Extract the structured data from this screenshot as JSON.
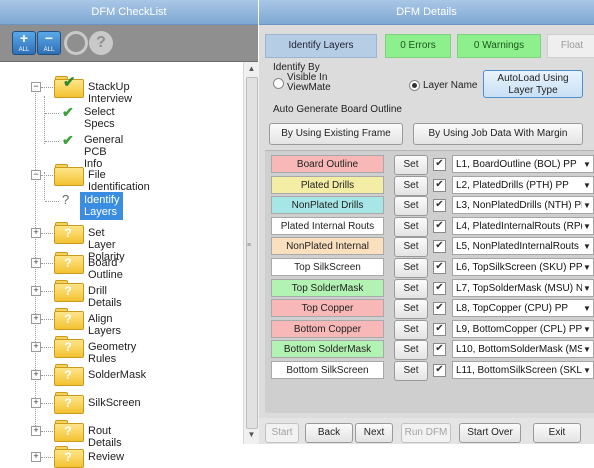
{
  "left_panel": {
    "title": "DFM CheckList"
  },
  "toolbar": {
    "add_symbol": "+",
    "add_label": "ALL",
    "remove_symbol": "−",
    "remove_label": "ALL",
    "help_symbol": "?"
  },
  "tree": {
    "items": [
      {
        "label": "StackUp Interview",
        "expanded": true,
        "icon": "folder-check-icon"
      },
      {
        "label": "Select Specs",
        "icon": "check-icon"
      },
      {
        "label": "General PCB Info",
        "icon": "check-icon"
      },
      {
        "label": "File Identification",
        "expanded": true,
        "icon": "folder-icon"
      },
      {
        "label": "Identify Layers",
        "icon": "question-icon",
        "selected": true
      },
      {
        "label": "Set Layer Polarity",
        "icon": "folder-question-icon"
      },
      {
        "label": "Board Outline",
        "icon": "folder-question-icon"
      },
      {
        "label": "Drill Details",
        "icon": "folder-question-icon"
      },
      {
        "label": "Align Layers",
        "icon": "folder-question-icon"
      },
      {
        "label": "Geometry Rules",
        "icon": "folder-question-icon"
      },
      {
        "label": "SolderMask",
        "icon": "folder-question-icon"
      },
      {
        "label": "SilkScreen",
        "icon": "folder-question-icon"
      },
      {
        "label": "Rout Details",
        "icon": "folder-question-icon"
      },
      {
        "label": "Review",
        "icon": "folder-question-icon"
      }
    ],
    "folder_q": "?",
    "check": "✔",
    "expander_minus": "−",
    "expander_plus": "+"
  },
  "right_panel": {
    "title": "DFM Details",
    "tabs": {
      "identify": "Identify Layers",
      "errors": "0 Errors",
      "warnings": "0 Warnings",
      "float": "Float"
    },
    "identify_by": {
      "label": "Identify By",
      "option1": "Visible In ViewMate",
      "option2": "Layer Name",
      "selected": "Layer Name",
      "autoload": "AutoLoad Using Layer Type"
    },
    "outline": {
      "label": "Auto Generate Board Outline",
      "existing_frame": "By Using Existing Frame",
      "job_data": "By Using Job Data With Margin"
    },
    "set_label": "Set",
    "check_mark": "✔",
    "dropdown_arrow": "▼",
    "layers": [
      {
        "name": "Board Outline",
        "color": "#f8b8b8",
        "checked": true,
        "value": "L1, BoardOutline (BOL) PP"
      },
      {
        "name": "Plated Drills",
        "color": "#f3eda6",
        "checked": true,
        "value": "L2, PlatedDrills (PTH) PP"
      },
      {
        "name": "NonPlated Drills",
        "color": "#a6e6e6",
        "checked": true,
        "value": "L3, NonPlatedDrills (NTH) PF"
      },
      {
        "name": "Plated Internal Routs",
        "color": "#ffffff",
        "checked": true,
        "value": "L4, PlatedInternalRouts (RP("
      },
      {
        "name": "NonPlated Internal Routs",
        "color": "#fbe0c0",
        "checked": true,
        "value": "L5, NonPlatedInternalRouts ("
      },
      {
        "name": "Top SilkScreen",
        "color": "#ffffff",
        "checked": true,
        "value": "L6, TopSilkScreen (SKU) PP"
      },
      {
        "name": "Top SolderMask",
        "color": "#b2f2b2",
        "checked": true,
        "value": "L7, TopSolderMask (MSU) N"
      },
      {
        "name": "Top Copper",
        "color": "#f8b8b8",
        "checked": true,
        "value": "L8, TopCopper (CPU) PP"
      },
      {
        "name": "Bottom Copper",
        "color": "#f8b8b8",
        "checked": true,
        "value": "L9, BottomCopper (CPL) PP"
      },
      {
        "name": "Bottom SolderMask",
        "color": "#b2f2b2",
        "checked": true,
        "value": "L10, BottomSolderMask (MS"
      },
      {
        "name": "Bottom SilkScreen",
        "color": "#ffffff",
        "checked": true,
        "value": "L11, BottomSilkScreen (SKL)"
      }
    ],
    "bottom": {
      "start": "Start",
      "back": "Back",
      "next": "Next",
      "run": "Run DFM",
      "start_over": "Start Over",
      "exit": "Exit"
    }
  },
  "colors": {
    "title_bar": "#8fb5dc",
    "selected_item": "#3a8de0",
    "errors_bg": "#8df08d",
    "toolbar_bg": "#8f8f8f"
  }
}
